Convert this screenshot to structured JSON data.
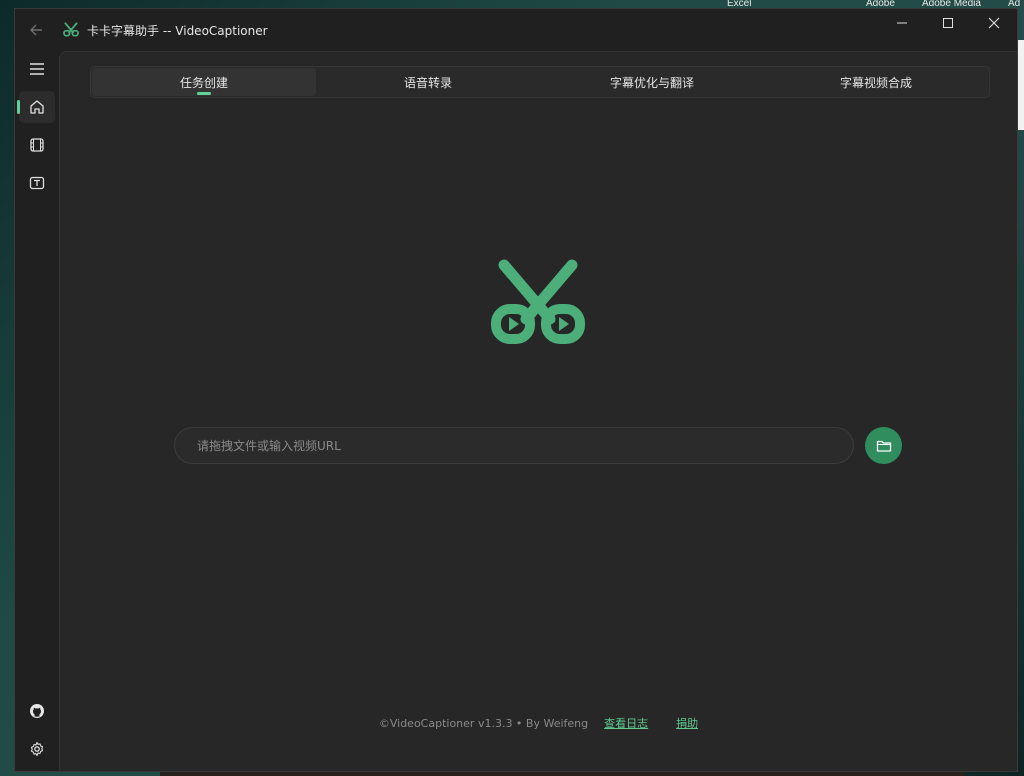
{
  "desktop": {
    "labels": [
      "Excel",
      "Adobe",
      "Adobe Media",
      "Ad"
    ]
  },
  "window": {
    "title": "卡卡字幕助手 -- VideoCaptioner",
    "controls": [
      "minimize-icon",
      "maximize-icon",
      "close-icon"
    ]
  },
  "sidebar": {
    "items": [
      {
        "icon": "menu-icon"
      },
      {
        "icon": "home-icon",
        "active": true
      },
      {
        "icon": "film-icon"
      },
      {
        "icon": "subtitle-icon"
      }
    ],
    "bottom_items": [
      {
        "icon": "github-icon"
      },
      {
        "icon": "settings-icon"
      }
    ]
  },
  "tabs": [
    {
      "label": "任务创建",
      "active": true
    },
    {
      "label": "语音转录"
    },
    {
      "label": "字幕优化与翻译"
    },
    {
      "label": "字幕视频合成"
    }
  ],
  "input": {
    "placeholder": "请拖拽文件或输入视频URL",
    "value": ""
  },
  "footer": {
    "text": "©VideoCaptioner v1.3.3 • By Weifeng",
    "link_log": "查看日志",
    "link_donate": "捐助"
  },
  "colors": {
    "accent": "#5fd19a",
    "brand_green": "#4caf7a",
    "button_green": "#2f8d5e",
    "background": "#272727"
  }
}
